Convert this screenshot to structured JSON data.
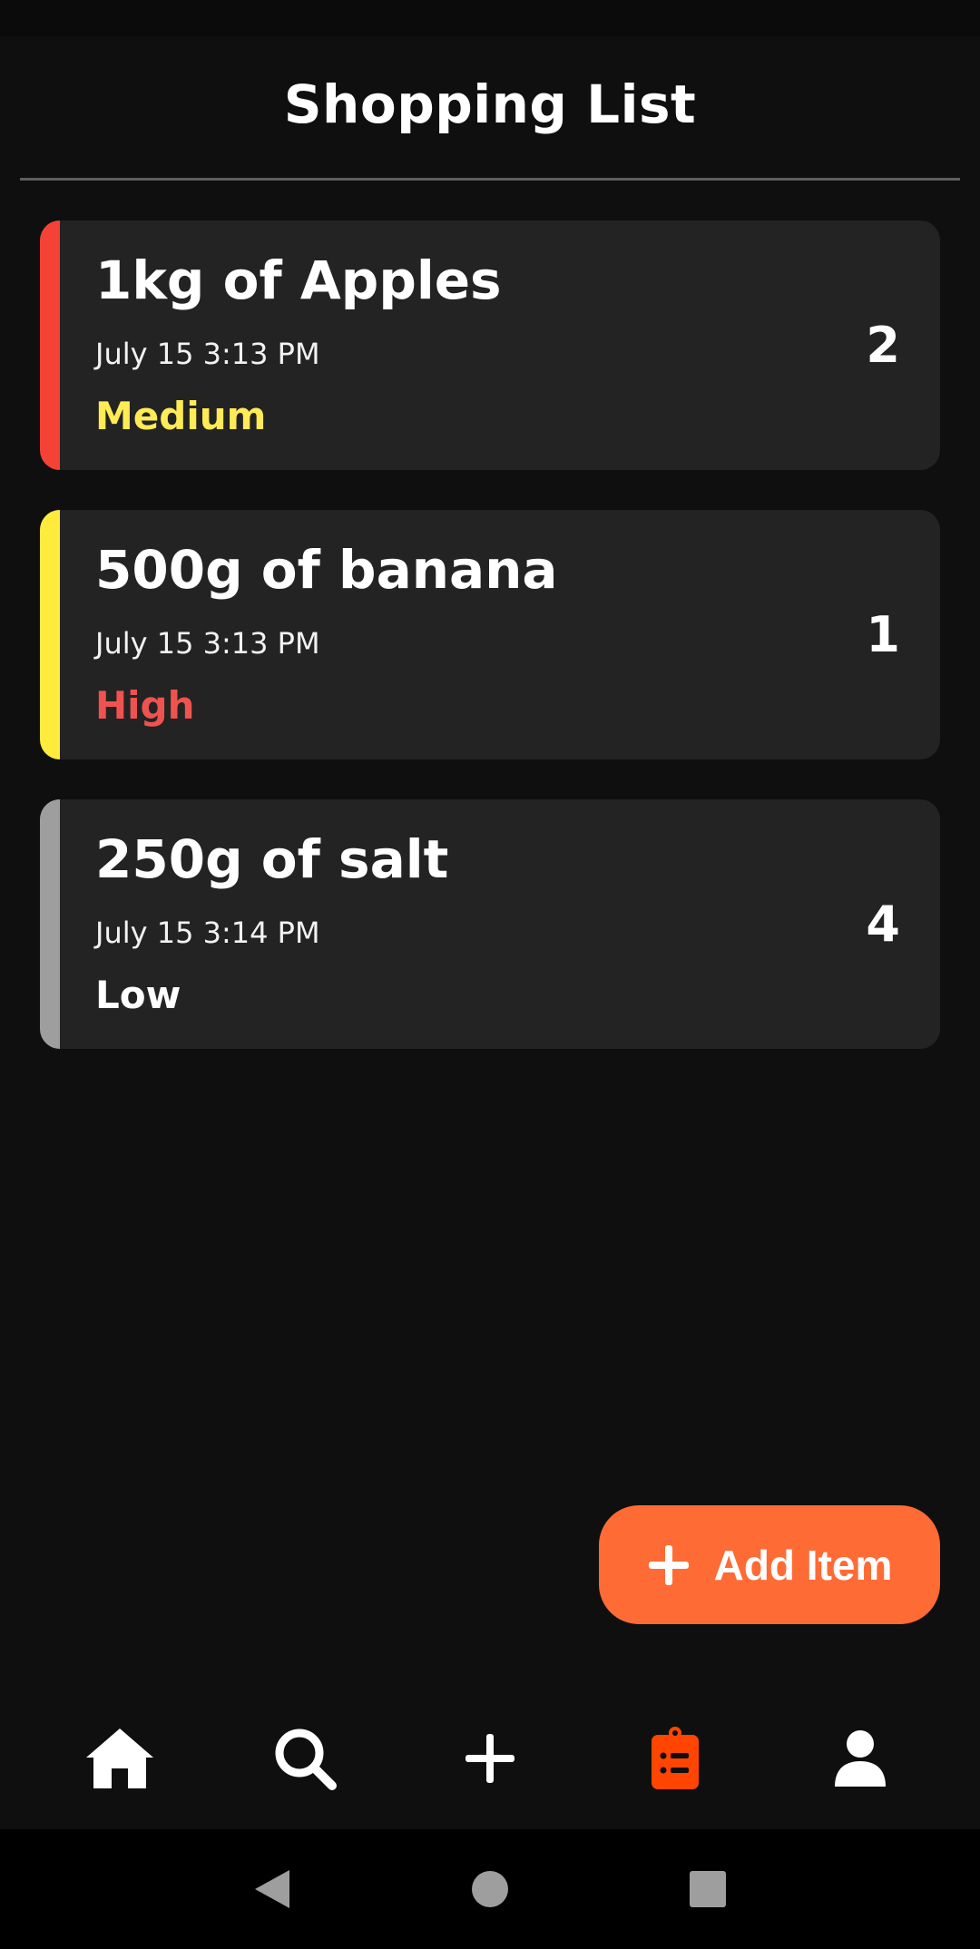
{
  "header": {
    "title": "Shopping List"
  },
  "items": [
    {
      "name": "1kg of Apples",
      "time": "July 15 3:13 PM",
      "priority": "Medium",
      "priority_color": "#ffeb55",
      "stripe_color": "#f44336",
      "quantity": "2"
    },
    {
      "name": "500g of banana",
      "time": "July 15 3:13 PM",
      "priority": "High",
      "priority_color": "#ef5350",
      "stripe_color": "#ffeb3b",
      "quantity": "1"
    },
    {
      "name": "250g of salt",
      "time": "July 15 3:14 PM",
      "priority": "Low",
      "priority_color": "#ffffff",
      "stripe_color": "#9e9e9e",
      "quantity": "4"
    }
  ],
  "fab": {
    "label": "Add Item",
    "icon": "plus-icon",
    "color": "#ff6b35"
  },
  "bottom_nav": [
    {
      "icon": "home-icon",
      "active": false
    },
    {
      "icon": "search-icon",
      "active": false
    },
    {
      "icon": "plus-icon",
      "active": false
    },
    {
      "icon": "clipboard-list-icon",
      "active": true
    },
    {
      "icon": "user-icon",
      "active": false
    }
  ],
  "colors": {
    "accent": "#ff4500",
    "background": "#0f0f0f",
    "card": "#232323"
  },
  "system_nav": [
    "back-icon",
    "home-circle-icon",
    "recents-icon"
  ]
}
